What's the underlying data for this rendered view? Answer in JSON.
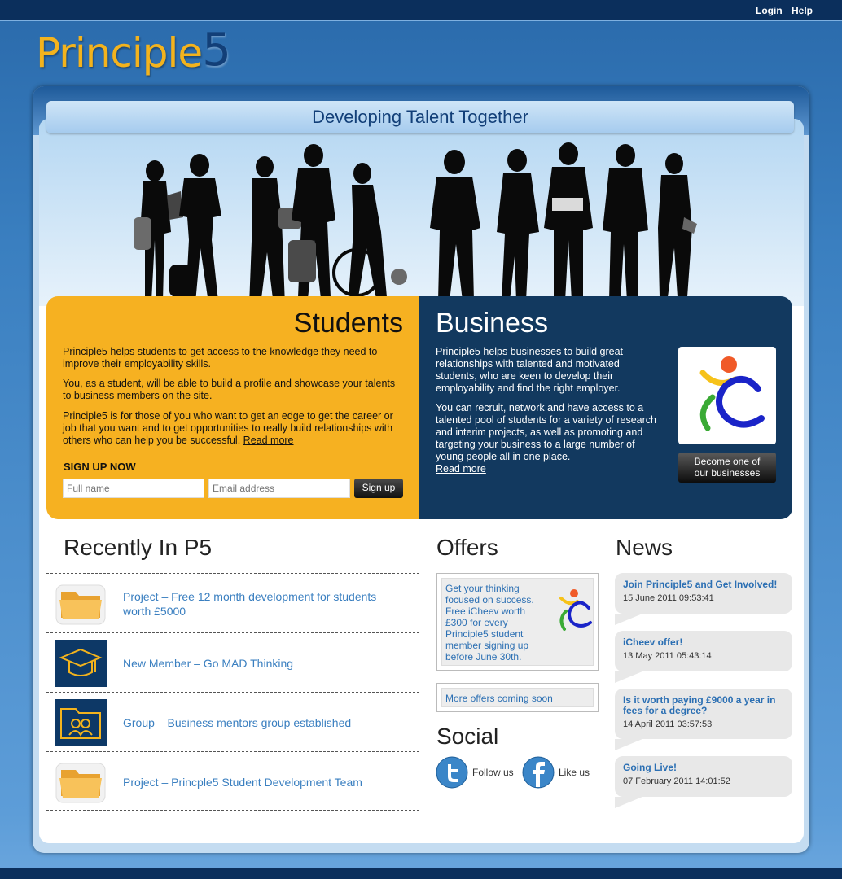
{
  "topnav": {
    "login": "Login",
    "help": "Help"
  },
  "logo": {
    "text": "Principle",
    "num": "5"
  },
  "tagline": "Developing Talent Together",
  "students": {
    "title": "Students",
    "p1": "Principle5 helps students to get access to the knowledge they need to improve their employability skills.",
    "p2": "You, as a student, will be able to build a profile and showcase your talents to business members on the site.",
    "p3": "Principle5 is for those of you who want to get an edge to get the career or job that you want and to get opportunities to really build relationships with others who can help you be successful.",
    "read_more": "Read more",
    "signup_title": "SIGN UP NOW",
    "fullname_placeholder": "Full name",
    "email_placeholder": "Email address",
    "signup_button": "Sign up"
  },
  "business": {
    "title": "Business",
    "p1": "Principle5 helps businesses to build great relationships with talented and motivated students, who are keen to develop their employability and find the right employer.",
    "p2": "You can recruit, network and have access to a talented pool of students for a variety of research and interim projects, as well as promoting and targeting your business to a large number of young people all in one place.",
    "read_more": "Read more",
    "become_line1": "Become one of",
    "become_line2": "our businesses"
  },
  "recent": {
    "title": "Recently In P5",
    "items": [
      {
        "icon": "folder-icon",
        "text": "Project – Free 12 month development for students worth £5000"
      },
      {
        "icon": "graduation-cap-icon",
        "text": "New Member – Go MAD Thinking"
      },
      {
        "icon": "group-folder-icon",
        "text": "Group – Business mentors group established"
      },
      {
        "icon": "folder-icon",
        "text": "Project – Princple5 Student Development Team"
      }
    ]
  },
  "offers": {
    "title": "Offers",
    "offer_text": "Get your thinking focused on success. Free iCheev worth £300 for every Principle5 student member signing up before June 30th.",
    "more_offers": "More offers coming soon"
  },
  "social": {
    "title": "Social",
    "twitter_label": "Follow us",
    "facebook_label": "Like us"
  },
  "news": {
    "title": "News",
    "items": [
      {
        "title": "Join Principle5 and Get Involved!",
        "date": "15 June 2011 09:53:41"
      },
      {
        "title": "iCheev offer!",
        "date": "13 May 2011 05:43:14"
      },
      {
        "title": "Is it worth paying £9000 a year in fees for a degree?",
        "date": "14 April 2011 03:57:53"
      },
      {
        "title": "Going Live!",
        "date": "07 February 2011 14:01:52"
      }
    ]
  },
  "colors": {
    "students_bg": "#f6b121",
    "business_bg": "#12395f",
    "link_blue": "#3a7fc0",
    "brand_gold": "#f3b31d",
    "brand_navy": "#123f78"
  }
}
